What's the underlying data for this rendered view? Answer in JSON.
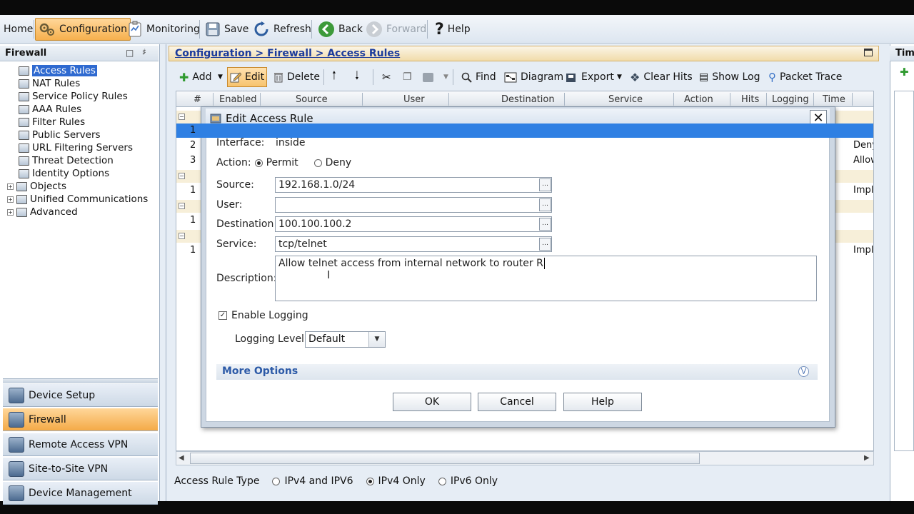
{
  "toolbar": {
    "home": "Home",
    "configuration": "Configuration",
    "monitoring": "Monitoring",
    "save": "Save",
    "refresh": "Refresh",
    "back": "Back",
    "forward": "Forward",
    "help": "Help"
  },
  "left_panel": {
    "title": "Firewall",
    "tree": [
      {
        "label": "Access Rules",
        "selected": true
      },
      {
        "label": "NAT Rules"
      },
      {
        "label": "Service Policy Rules"
      },
      {
        "label": "AAA Rules"
      },
      {
        "label": "Filter Rules"
      },
      {
        "label": "Public Servers"
      },
      {
        "label": "URL Filtering Servers"
      },
      {
        "label": "Threat Detection"
      },
      {
        "label": "Identity Options"
      },
      {
        "label": "Objects",
        "expandable": true
      },
      {
        "label": "Unified Communications",
        "expandable": true
      },
      {
        "label": "Advanced",
        "expandable": true
      }
    ],
    "nav": [
      {
        "label": "Device Setup"
      },
      {
        "label": "Firewall",
        "active": true
      },
      {
        "label": "Remote Access VPN"
      },
      {
        "label": "Site-to-Site VPN"
      },
      {
        "label": "Device Management"
      }
    ]
  },
  "main": {
    "breadcrumb": "Configuration > Firewall > Access Rules",
    "tools": {
      "add": "Add",
      "edit": "Edit",
      "delete": "Delete",
      "find": "Find",
      "diagram": "Diagram",
      "export": "Export",
      "clear_hits": "Clear Hits",
      "show_log": "Show Log",
      "packet_trace": "Packet Trace"
    },
    "columns": [
      "#",
      "Enabled",
      "Source",
      "User",
      "Destination",
      "Service",
      "Action",
      "Hits",
      "Logging",
      "Time"
    ],
    "row_numbers": [
      "1",
      "2",
      "3",
      "1",
      "1",
      "1"
    ],
    "right_column_values": [
      "Deny",
      "Allow",
      "Impl",
      "Impl"
    ],
    "access_rule_type": {
      "label": "Access Rule Type",
      "options": [
        "IPv4 and IPV6",
        "IPv4 Only",
        "IPv6 Only"
      ],
      "selected": "IPv4 Only"
    }
  },
  "right_panel": {
    "title": "Time"
  },
  "dialog": {
    "title": "Edit Access Rule",
    "interface_label": "Interface:",
    "interface_value": "inside",
    "action_label": "Action:",
    "permit_label": "Permit",
    "deny_label": "Deny",
    "action_selected": "Permit",
    "source_label": "Source:",
    "source_value": "192.168.1.0/24",
    "user_label": "User:",
    "user_value": "",
    "destination_label": "Destination",
    "destination_value": "100.100.100.2",
    "service_label": "Service:",
    "service_value": "tcp/telnet",
    "description_label": "Description:",
    "description_value": "Allow telnet access from internal network to router R",
    "enable_logging_label": "Enable Logging",
    "enable_logging_checked": true,
    "logging_level_label": "Logging Level:",
    "logging_level_value": "Default",
    "more_options_label": "More Options",
    "ok": "OK",
    "cancel": "Cancel",
    "help": "Help"
  }
}
